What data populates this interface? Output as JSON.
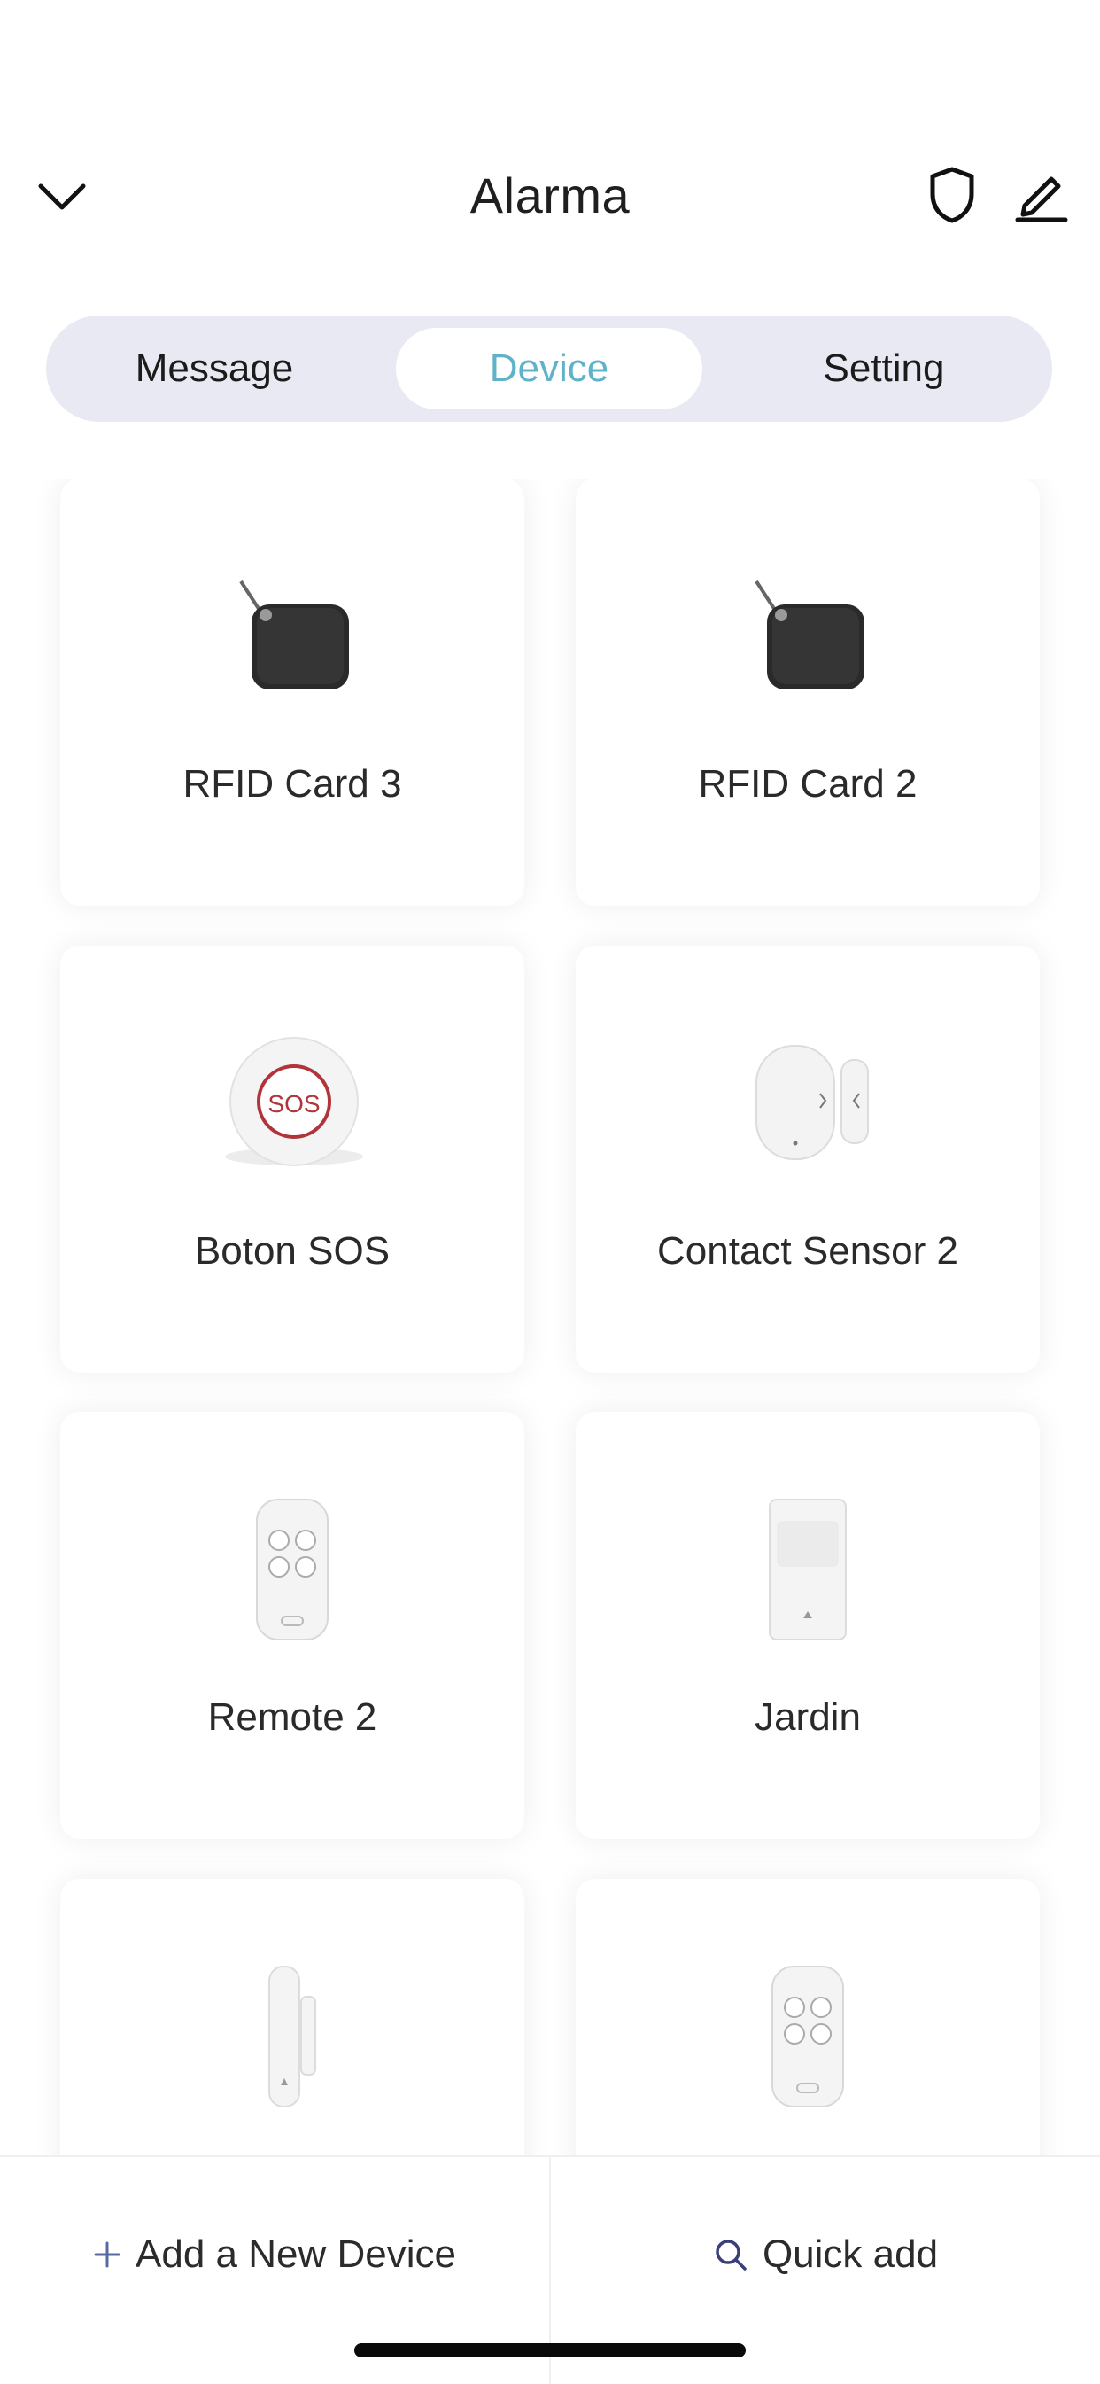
{
  "header": {
    "title": "Alarma"
  },
  "tabs": [
    {
      "label": "Message",
      "active": false
    },
    {
      "label": "Device",
      "active": true
    },
    {
      "label": "Setting",
      "active": false
    }
  ],
  "devices": [
    {
      "name": "RFID Card 3",
      "icon": "rfid-card-icon"
    },
    {
      "name": "RFID Card 2",
      "icon": "rfid-card-icon"
    },
    {
      "name": "Boton SOS",
      "icon": "sos-button-icon",
      "badge": "SOS"
    },
    {
      "name": "Contact Sensor 2",
      "icon": "contact-sensor-icon"
    },
    {
      "name": "Remote 2",
      "icon": "remote-control-icon"
    },
    {
      "name": "Jardin",
      "icon": "motion-sensor-icon"
    },
    {
      "name": "",
      "icon": "door-sensor-icon"
    },
    {
      "name": "",
      "icon": "remote-control-icon"
    }
  ],
  "bottom_bar": {
    "add_label": "Add a New Device",
    "quick_label": "Quick add"
  },
  "colors": {
    "accent": "#5fb3c8",
    "tab_bg": "#e8e9f3",
    "sos_red": "#b0343a",
    "add_icon": "#5a6aa0"
  }
}
